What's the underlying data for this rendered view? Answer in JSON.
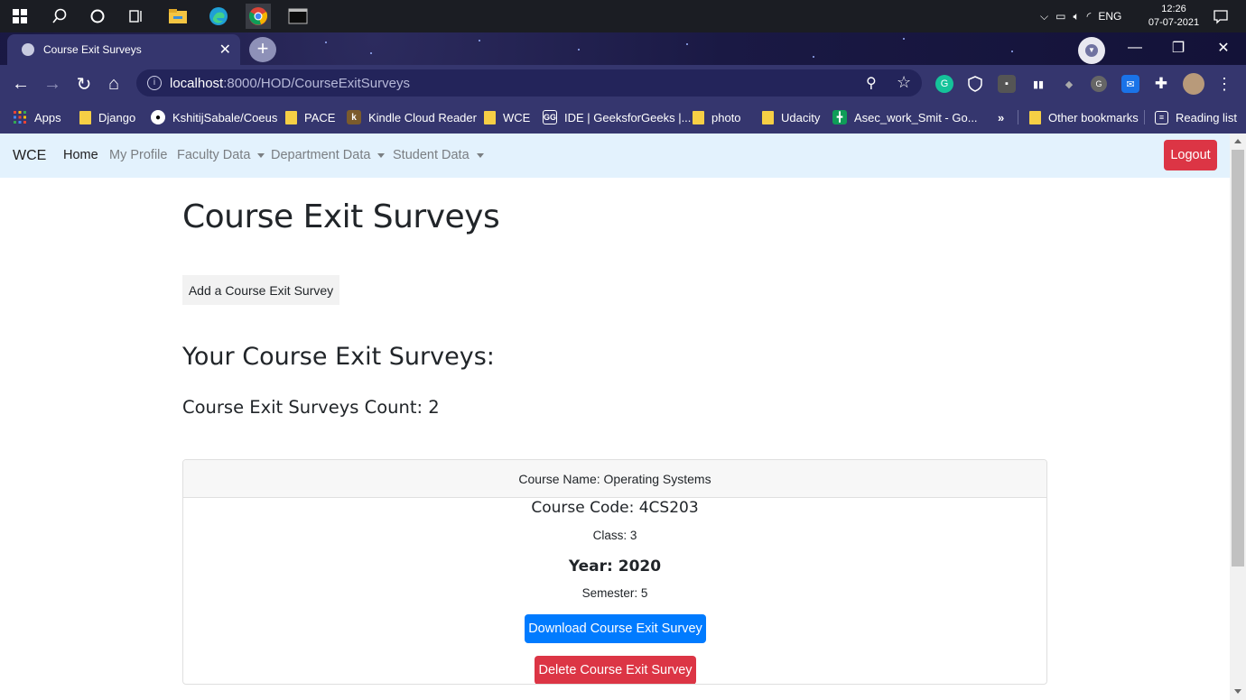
{
  "taskbar": {
    "time": "12:26",
    "date": "07-07-2021",
    "lang": "ENG"
  },
  "browser": {
    "tab_title": "Course Exit Surveys",
    "url_host": "localhost",
    "url_path": ":8000/HOD/CourseExitSurveys",
    "bookmarks": [
      {
        "label": "Apps",
        "icon": "apps-grid-icon"
      },
      {
        "label": "Django",
        "icon": "folder-icon"
      },
      {
        "label": "KshitijSabale/Coeus",
        "icon": "github-icon"
      },
      {
        "label": "PACE",
        "icon": "folder-icon"
      },
      {
        "label": "Kindle Cloud Reader",
        "icon": "kindle-icon"
      },
      {
        "label": "WCE",
        "icon": "folder-icon"
      },
      {
        "label": "IDE | GeeksforGeeks |...",
        "icon": "geeksforgeeks-icon"
      },
      {
        "label": "photo",
        "icon": "folder-icon"
      },
      {
        "label": "Udacity",
        "icon": "folder-icon"
      },
      {
        "label": "Asec_work_Smit - Go...",
        "icon": "google-sheets-icon"
      }
    ],
    "more_bookmarks": "»",
    "other_bookmarks": "Other bookmarks",
    "reading_list": "Reading list"
  },
  "navbar": {
    "brand": "WCE",
    "links": [
      {
        "label": "Home",
        "dropdown": false
      },
      {
        "label": "My Profile",
        "dropdown": false
      },
      {
        "label": "Faculty Data",
        "dropdown": true
      },
      {
        "label": "Department Data",
        "dropdown": true
      },
      {
        "label": "Student Data",
        "dropdown": true
      }
    ],
    "logout": "Logout"
  },
  "page": {
    "title": "Course Exit Surveys",
    "add_button": "Add a Course Exit Survey",
    "section_title": "Your Course Exit Surveys:",
    "count_text": "Course Exit Surveys Count: 2"
  },
  "survey_card": {
    "course_name": "Course Name: Operating Systems",
    "course_code": "Course Code: 4CS203",
    "class": "Class: 3",
    "year": "Year: 2020",
    "semester": "Semester: 5",
    "download_button": "Download Course Exit Survey",
    "delete_button": "Delete Course Exit Survey"
  },
  "colors": {
    "navbar_bg": "#e3f2fd",
    "danger": "#dc3545",
    "primary": "#007bff",
    "browser_chrome": "#35366e"
  }
}
